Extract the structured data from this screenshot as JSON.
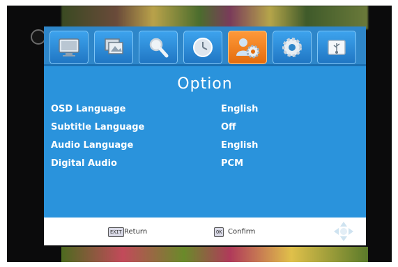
{
  "menu": {
    "title": "Option",
    "tabs": [
      {
        "icon": "monitor-icon"
      },
      {
        "icon": "picture-icon"
      },
      {
        "icon": "search-icon"
      },
      {
        "icon": "clock-icon"
      },
      {
        "icon": "user-settings-icon",
        "active": true
      },
      {
        "icon": "gear-icon"
      },
      {
        "icon": "usb-icon"
      }
    ],
    "rows": [
      {
        "label": "OSD Language",
        "value": "English"
      },
      {
        "label": "Subtitle Language",
        "value": "Off"
      },
      {
        "label": "Audio Language",
        "value": "English"
      },
      {
        "label": "Digital Audio",
        "value": "PCM"
      }
    ]
  },
  "footer": {
    "exit_key": "EXIT",
    "exit_label": "Return",
    "ok_key": "OK",
    "ok_label": "Confirm"
  },
  "colors": {
    "menu_bg": "#2a93dc",
    "active_tab": "#f07a1a",
    "text": "#ffffff"
  }
}
